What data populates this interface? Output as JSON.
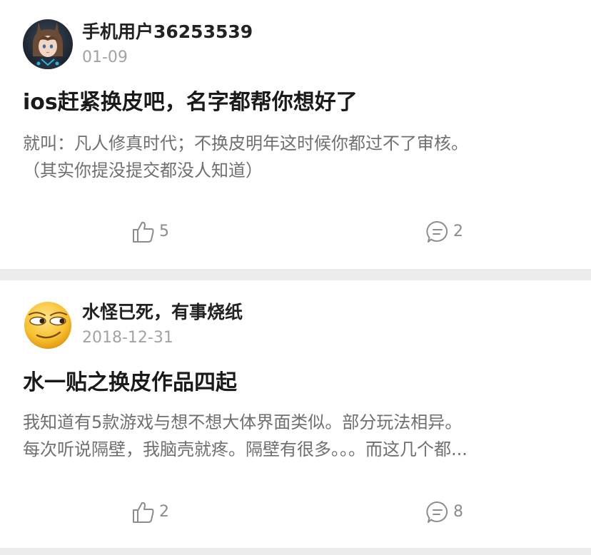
{
  "posts": [
    {
      "username": "手机用户36253539",
      "date": "01-09",
      "title": "ios赶紧换皮吧，名字都帮你想好了",
      "body_lines": [
        "就叫：凡人修真时代；不换皮明年这时候你都过不了审核。",
        "（其实你提没提交都没人知道）"
      ],
      "likes": "5",
      "comments": "2",
      "avatar": "anime-girl-avatar"
    },
    {
      "username": "水怪已死，有事烧纸",
      "date": "2018-12-31",
      "title": "水一贴之换皮作品四起",
      "body_lines": [
        "我知道有5款游戏与想不想大体界面类似。部分玩法相异。",
        "每次听说隔壁，我脑壳就疼。隔壁有很多。。。而这几个都..."
      ],
      "likes": "2",
      "comments": "8",
      "avatar": "smirk-emoji-avatar"
    }
  ],
  "icons": {
    "like": "thumbs-up-icon",
    "comment": "comment-bubble-icon"
  },
  "colors": {
    "background": "#ebebeb",
    "card": "#ffffff",
    "title": "#1a1a1a",
    "body": "#6f6f6f",
    "meta": "#a3a3a3",
    "action": "#8c8c8c"
  }
}
